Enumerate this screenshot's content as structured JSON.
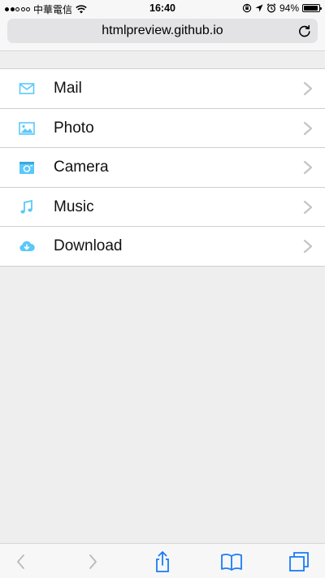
{
  "status_bar": {
    "carrier": "中華電信",
    "time": "16:40",
    "battery": "94%",
    "battery_level": 0.94,
    "signal_bars": 2,
    "signal_total": 5
  },
  "address_bar": {
    "url": "htmlpreview.github.io"
  },
  "menu": {
    "items": [
      {
        "label": "Mail",
        "icon": "mail-icon"
      },
      {
        "label": "Photo",
        "icon": "photo-icon"
      },
      {
        "label": "Camera",
        "icon": "camera-icon"
      },
      {
        "label": "Music",
        "icon": "music-icon"
      },
      {
        "label": "Download",
        "icon": "download-cloud-icon"
      }
    ]
  },
  "toolbar": {
    "buttons": [
      "back-icon",
      "forward-icon",
      "share-icon",
      "bookmarks-icon",
      "tabs-icon"
    ]
  },
  "colors": {
    "icon_accent": "#5ac8fa",
    "toolbar_accent": "#1a7cf5",
    "disabled": "#b9b9bf",
    "chevron": "#c4c4c9",
    "background": "#eeeeee"
  }
}
